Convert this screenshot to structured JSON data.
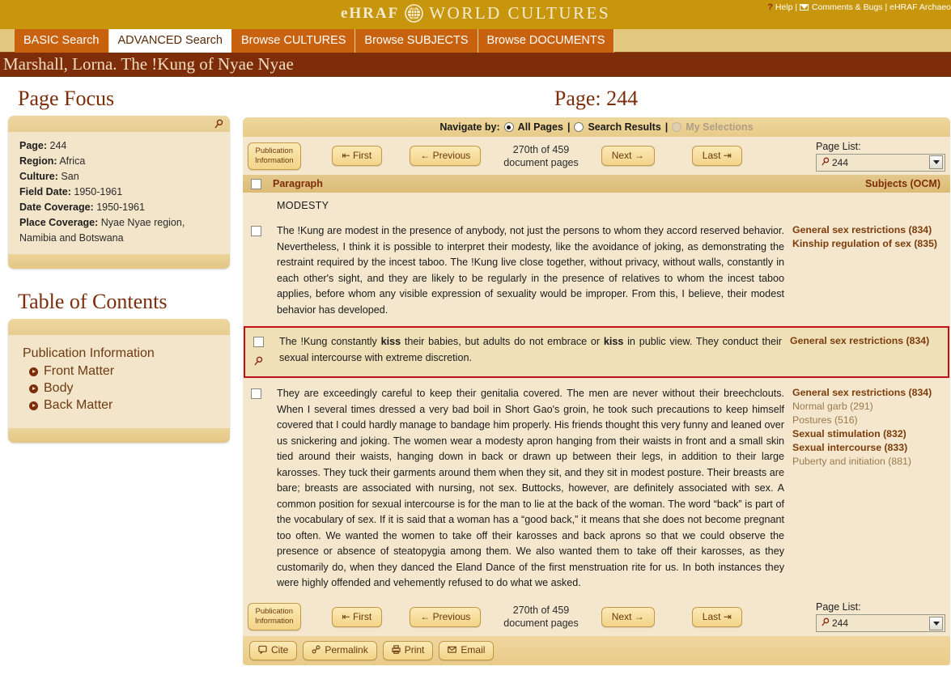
{
  "header": {
    "brand_ehraf": "eHRAF",
    "brand_world": "WORLD CULTURES",
    "utility": {
      "help": "Help",
      "sep1": "|",
      "comments": "Comments & Bugs",
      "sep2": "|",
      "archaeology": "eHRAF Archaeo"
    }
  },
  "tabs": [
    {
      "label": "BASIC Search",
      "active": false
    },
    {
      "label": "ADVANCED Search",
      "active": true
    },
    {
      "label": "Browse CULTURES",
      "active": false
    },
    {
      "label": "Browse SUBJECTS",
      "active": false
    },
    {
      "label": "Browse DOCUMENTS",
      "active": false
    }
  ],
  "document_title": "Marshall, Lorna. The !Kung of Nyae Nyae",
  "page_focus": {
    "heading": "Page Focus",
    "fields": [
      {
        "label": "Page:",
        "value": "244"
      },
      {
        "label": "Region:",
        "value": "Africa"
      },
      {
        "label": "Culture:",
        "value": "San"
      },
      {
        "label": "Field Date:",
        "value": "1950-1961"
      },
      {
        "label": "Date Coverage:",
        "value": "1950-1961"
      },
      {
        "label": "Place Coverage:",
        "value": "Nyae Nyae region, Namibia and Botswana"
      }
    ]
  },
  "toc": {
    "heading": "Table of Contents",
    "root": "Publication Information",
    "items": [
      {
        "label": "Front Matter"
      },
      {
        "label": "Body"
      },
      {
        "label": "Back Matter"
      }
    ]
  },
  "main": {
    "page_title": "Page: 244",
    "navigate_by": {
      "label": "Navigate by:",
      "options": [
        {
          "label": "All Pages",
          "selected": true,
          "disabled": false
        },
        {
          "label": "Search Results",
          "selected": false,
          "disabled": false
        },
        {
          "label": "My Selections",
          "selected": false,
          "disabled": true
        }
      ],
      "separator": "|"
    },
    "nav": {
      "publication_information": "Publication Information",
      "publication_information_line1": "Publication",
      "publication_information_line2": "Information",
      "first": "First",
      "previous": "Previous",
      "next": "Next",
      "last": "Last",
      "count_line1": "270th of 459",
      "count_line2": "document pages",
      "page_list_label": "Page List:",
      "page_list_value": "244"
    },
    "table_header": {
      "paragraph": "Paragraph",
      "subjects": "Subjects (OCM)"
    },
    "section_heading": "MODESTY",
    "paragraphs": [
      {
        "id": "p1",
        "highlighted": false,
        "text_html": "The !Kung are modest in the presence of anybody, not just the persons to whom they accord reserved behavior. Nevertheless, I think it is possible to interpret their modesty, like the avoidance of joking, as demonstrating the restraint required by the incest taboo. The !Kung live close together, without privacy, without walls, constantly in each other's sight, and they are likely to be regularly in the presence of relatives to whom the incest taboo applies, before whom any visible expression of sexuality would be improper. From this, I believe, their modest behavior has developed.",
        "subjects": [
          {
            "label": "General sex restrictions (834)",
            "bold": true
          },
          {
            "label": "Kinship regulation of sex (835)",
            "bold": true
          }
        ]
      },
      {
        "id": "p2",
        "highlighted": true,
        "text_html": "The !Kung constantly <b>kiss</b> their babies, but adults do not embrace or <b>kiss</b> in public view. They conduct their sexual intercourse with extreme discretion.",
        "subjects": [
          {
            "label": "General sex restrictions (834)",
            "bold": true
          }
        ]
      },
      {
        "id": "p3",
        "highlighted": false,
        "text_html": "They are exceedingly careful to keep their genitalia covered. The men are never without their breechclouts. When I several times dressed a very bad boil in Short Gao's groin, he took such precautions to keep himself covered that I could hardly manage to bandage him properly. His friends thought this very funny and leaned over us snickering and joking. The women wear a modesty apron hanging from their waists in front and a small skin tied around their waists, hanging down in back or drawn up between their legs, in addition to their large karosses. They tuck their garments around them when they sit, and they sit in modest posture. Their breasts are bare; breasts are associated with nursing, not sex. Buttocks, however, are definitely associated with sex. A common position for sexual intercourse is for the man to lie at the back of the woman. The word “back” is part of the vocabulary of sex. If it is said that a woman has a “good back,” it means that she does not become pregnant too often. We wanted the women to take off their karosses and back aprons so that we could observe the presence or absence of steatopygia among them. We also wanted them to take off their karosses, as they customarily do, when they danced the Eland Dance of the first menstruation rite for us. In both instances they were highly offended and vehemently refused to do what we asked.",
        "subjects": [
          {
            "label": "General sex restrictions (834)",
            "bold": true
          },
          {
            "label": "Normal garb (291)",
            "bold": false
          },
          {
            "label": "Postures (516)",
            "bold": false
          },
          {
            "label": "Sexual stimulation (832)",
            "bold": true
          },
          {
            "label": "Sexual intercourse (833)",
            "bold": true
          },
          {
            "label": "Puberty and initiation (881)",
            "bold": false
          }
        ]
      }
    ],
    "tools": [
      {
        "label": "Cite",
        "icon": "cite-icon"
      },
      {
        "label": "Permalink",
        "icon": "link-icon"
      },
      {
        "label": "Print",
        "icon": "printer-icon"
      },
      {
        "label": "Email",
        "icon": "envelope-icon"
      }
    ]
  },
  "colors": {
    "gold": "#c8960c",
    "tab_orange": "#c9620f",
    "title_brown": "#7d2d09",
    "panel_cream": "#f3e5c9",
    "highlight_red": "#c0111c"
  }
}
